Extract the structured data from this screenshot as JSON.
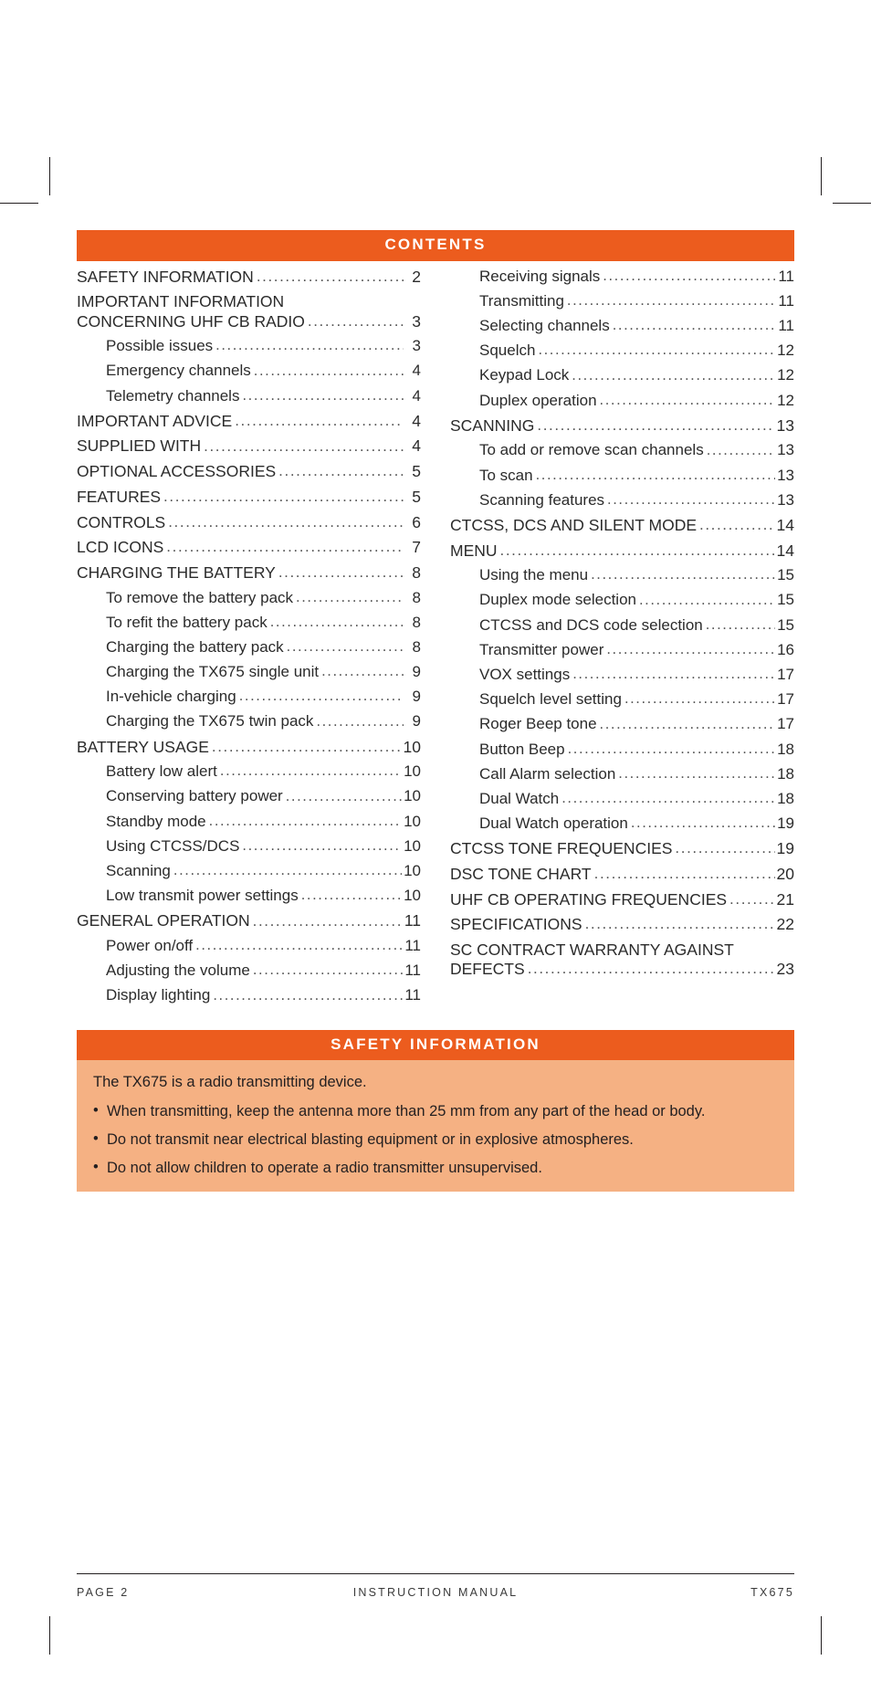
{
  "colors": {
    "accent": "#ec5c1e",
    "panel_bg": "#f5b183",
    "text": "#231f20"
  },
  "contents": {
    "heading": "CONTENTS",
    "left_column": [
      {
        "label": "SAFETY INFORMATION",
        "page": "2",
        "level": 1
      },
      {
        "label": "IMPORTANT INFORMATION",
        "label2": "CONCERNING UHF CB RADIO",
        "page": "3",
        "level": 1,
        "wrap": true
      },
      {
        "label": "Possible issues",
        "page": "3",
        "level": 2
      },
      {
        "label": "Emergency channels",
        "page": "4",
        "level": 2
      },
      {
        "label": "Telemetry channels",
        "page": "4",
        "level": 2
      },
      {
        "label": "IMPORTANT ADVICE",
        "page": "4",
        "level": 1
      },
      {
        "label": "SUPPLIED WITH",
        "page": "4",
        "level": 1
      },
      {
        "label": "OPTIONAL ACCESSORIES",
        "page": "5",
        "level": 1
      },
      {
        "label": "FEATURES",
        "page": "5",
        "level": 1
      },
      {
        "label": "CONTROLS",
        "page": "6",
        "level": 1
      },
      {
        "label": "LCD ICONS ",
        "page": "7",
        "level": 1
      },
      {
        "label": "CHARGING THE BATTERY",
        "page": "8",
        "level": 1
      },
      {
        "label": "To remove the battery pack",
        "page": "8",
        "level": 2
      },
      {
        "label": "To refit the battery pack",
        "page": "8",
        "level": 2
      },
      {
        "label": "Charging the battery pack",
        "page": "8",
        "level": 2
      },
      {
        "label": "Charging the TX675 single unit",
        "page": "9",
        "level": 2
      },
      {
        "label": "In-vehicle charging",
        "page": "9",
        "level": 2
      },
      {
        "label": "Charging the TX675 twin pack",
        "page": "9",
        "level": 2
      },
      {
        "label": "BATTERY USAGE",
        "page": "10",
        "level": 1
      },
      {
        "label": "Battery low alert",
        "page": "10",
        "level": 2
      },
      {
        "label": "Conserving battery power",
        "page": "10",
        "level": 2
      },
      {
        "label": "Standby mode",
        "page": "10",
        "level": 2
      },
      {
        "label": "Using CTCSS/DCS",
        "page": "10",
        "level": 2
      },
      {
        "label": "Scanning",
        "page": "10",
        "level": 2
      },
      {
        "label": "Low transmit power settings",
        "page": "10",
        "level": 2
      },
      {
        "label": "GENERAL OPERATION",
        "page": "11",
        "level": 1
      },
      {
        "label": "Power on/off",
        "page": "11",
        "level": 2
      },
      {
        "label": "Adjusting the volume",
        "page": "11",
        "level": 2
      },
      {
        "label": "Display lighting",
        "page": "11",
        "level": 2
      }
    ],
    "right_column": [
      {
        "label": "Receiving signals",
        "page": "11",
        "level": 2
      },
      {
        "label": "Transmitting",
        "page": "11",
        "level": 2
      },
      {
        "label": "Selecting channels",
        "page": "11",
        "level": 2
      },
      {
        "label": "Squelch",
        "page": "12",
        "level": 2
      },
      {
        "label": "Keypad Lock",
        "page": "12",
        "level": 2
      },
      {
        "label": "Duplex operation",
        "page": "12",
        "level": 2
      },
      {
        "label": "SCANNING",
        "page": "13",
        "level": 1
      },
      {
        "label": "To add or remove scan channels",
        "page": "13",
        "level": 2
      },
      {
        "label": "To scan",
        "page": "13",
        "level": 2
      },
      {
        "label": "Scanning features",
        "page": "13",
        "level": 2
      },
      {
        "label": "CTCSS, DCS AND SILENT MODE",
        "page": "14",
        "level": 1
      },
      {
        "label": "MENU",
        "page": "14",
        "level": 1
      },
      {
        "label": "Using the menu",
        "page": "15",
        "level": 2
      },
      {
        "label": "Duplex mode selection",
        "page": "15",
        "level": 2
      },
      {
        "label": "CTCSS and DCS code selection",
        "page": "15",
        "level": 2
      },
      {
        "label": "Transmitter power",
        "page": "16",
        "level": 2
      },
      {
        "label": "VOX settings",
        "page": "17",
        "level": 2
      },
      {
        "label": "Squelch level setting",
        "page": "17",
        "level": 2
      },
      {
        "label": "Roger Beep tone",
        "page": "17",
        "level": 2
      },
      {
        "label": "Button Beep",
        "page": "18",
        "level": 2
      },
      {
        "label": "Call Alarm selection",
        "page": "18",
        "level": 2
      },
      {
        "label": "Dual Watch",
        "page": "18",
        "level": 2
      },
      {
        "label": "Dual Watch operation",
        "page": "19",
        "level": 2
      },
      {
        "label": "CTCSS TONE FREQUENCIES",
        "page": "19",
        "level": 1
      },
      {
        "label": "DSC TONE CHART",
        "page": "20",
        "level": 1
      },
      {
        "label": "UHF CB OPERATING FREQUENCIES",
        "page": "21",
        "level": 1
      },
      {
        "label": "SPECIFICATIONS ",
        "page": "22",
        "level": 1
      },
      {
        "label": "SC CONTRACT WARRANTY AGAINST",
        "label2": "DEFECTS",
        "page": "23",
        "level": 1,
        "wrap": true
      }
    ]
  },
  "safety": {
    "heading": "SAFETY INFORMATION",
    "intro": "The TX675 is a radio transmitting device.",
    "bullets": [
      "When transmitting, keep the antenna more than 25 mm from any part of the head or body.",
      "Do not transmit near electrical blasting equipment or in explosive atmospheres.",
      "Do not allow children to operate a radio transmitter unsupervised."
    ]
  },
  "footer": {
    "page": "PAGE 2",
    "center": "INSTRUCTION MANUAL",
    "model": "TX675"
  }
}
